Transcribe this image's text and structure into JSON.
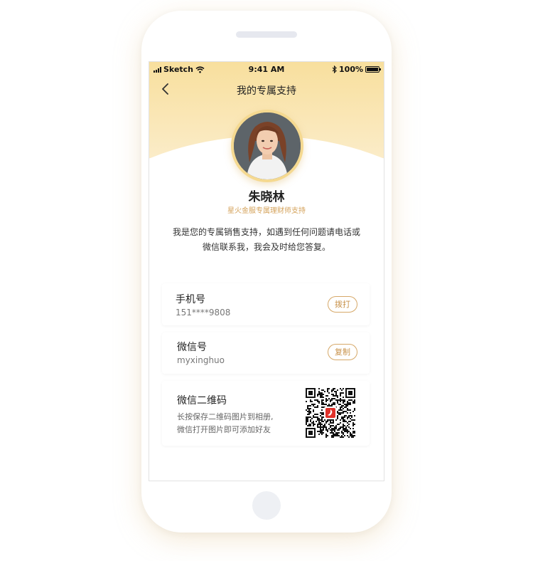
{
  "status_bar": {
    "carrier": "Sketch",
    "time": "9:41 AM",
    "battery": "100%"
  },
  "nav": {
    "title": "我的专属支持"
  },
  "profile": {
    "name": "朱晓林",
    "subtitle": "星火金服专属理财师支持"
  },
  "intro": {
    "line1": "我是您的专属销售支持，如遇到任何问题请电话或",
    "line2": "微信联系我，我会及时给您答复。"
  },
  "phone_card": {
    "title": "手机号",
    "value": "151****9808",
    "action": "拨打"
  },
  "wechat_card": {
    "title": "微信号",
    "value": "myxinghuo",
    "action": "复制"
  },
  "qr_card": {
    "title": "微信二维码",
    "desc_line1": "长按保存二维码图片到相册,",
    "desc_line2": "微信打开图片即可添加好友"
  },
  "colors": {
    "accent": "#d4a25a",
    "hero_top": "#f8df9d",
    "hero_bottom": "#fbecc8",
    "qr_logo": "#e0322b"
  },
  "icons": [
    "back-chevron-icon",
    "signal-icon",
    "wifi-icon",
    "bluetooth-icon",
    "battery-icon",
    "qr-code"
  ]
}
